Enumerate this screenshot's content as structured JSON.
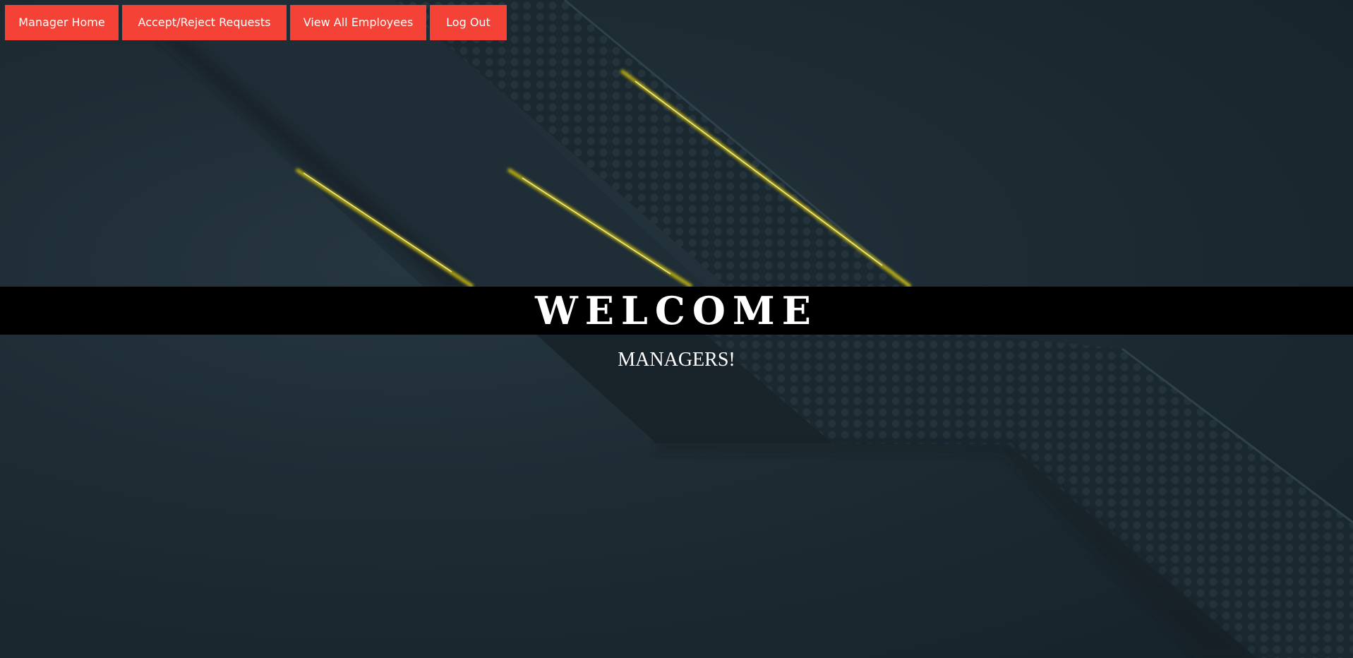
{
  "nav": {
    "items": [
      {
        "label": "Manager Home"
      },
      {
        "label": "Accept/Reject Requests"
      },
      {
        "label": "View All Employees"
      },
      {
        "label": "Log Out"
      }
    ]
  },
  "hero": {
    "title": "WELCOME",
    "subtitle": "MANAGERS!"
  },
  "colors": {
    "nav_button_bg": "#f44336",
    "band_bg": "#000000",
    "accent_glow": "#f5e400",
    "background": "#1d2b33"
  }
}
